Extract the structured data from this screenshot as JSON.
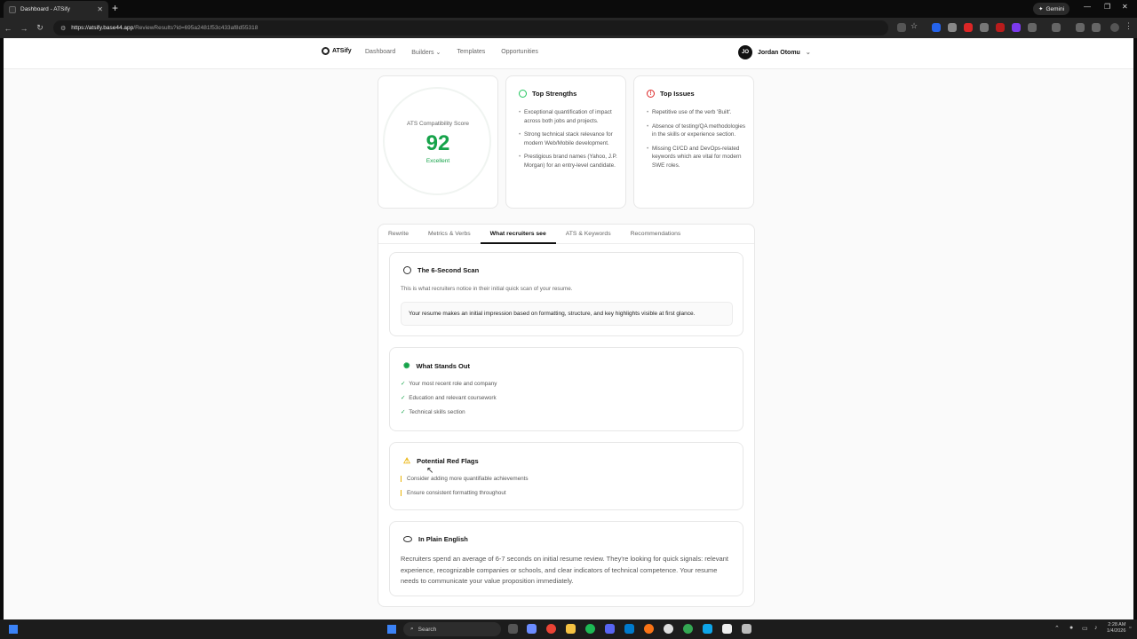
{
  "browser": {
    "tab_title": "Dashboard - ATSify",
    "url_host": "https://atsify.base44.app",
    "url_path": "/ReviewResults?id=695a2481f53c433af8d55318",
    "gemini_label": "Gemini"
  },
  "app": {
    "logo": "ATSify",
    "nav": [
      "Dashboard",
      "Builders",
      "Templates",
      "Opportunities"
    ],
    "user_initials": "JO",
    "user_name": "Jordan Otomu"
  },
  "score": {
    "label": "ATS Compatibility Score",
    "value": "92",
    "rating": "Excellent"
  },
  "strengths": {
    "title": "Top Strengths",
    "items": [
      "Exceptional quantification of impact across both jobs and projects.",
      "Strong technical stack relevance for modern Web/Mobile development.",
      "Prestigious brand names (Yahoo, J.P. Morgan) for an entry-level candidate."
    ]
  },
  "issues": {
    "title": "Top Issues",
    "items": [
      "Repetitive use of the verb 'Built'.",
      "Absence of testing/QA methodologies in the skills or experience section.",
      "Missing CI/CD and DevOps-related keywords which are vital for modern SWE roles."
    ]
  },
  "tabs": [
    "Rewrite",
    "Metrics & Verbs",
    "What recruiters see",
    "ATS & Keywords",
    "Recommendations"
  ],
  "scan": {
    "title": "The 6-Second Scan",
    "desc": "This is what recruiters notice in their initial quick scan of your resume.",
    "quote": "Your resume makes an initial impression based on formatting, structure, and key highlights visible at first glance."
  },
  "standout": {
    "title": "What Stands Out",
    "items": [
      "Your most recent role and company",
      "Education and relevant coursework",
      "Technical skills section"
    ]
  },
  "flags": {
    "title": "Potential Red Flags",
    "items": [
      "Consider adding more quantifiable achievements",
      "Ensure consistent formatting throughout"
    ]
  },
  "plain": {
    "title": "In Plain English",
    "text": "Recruiters spend an average of 6-7 seconds on initial resume review. They're looking for quick signals: relevant experience, recognizable companies or schools, and clear indicators of technical competence. Your resume needs to communicate your value proposition immediately."
  },
  "taskbar": {
    "search": "Search",
    "time": "2:28 AM",
    "date": "1/4/2026"
  },
  "colors": {
    "accent_green": "#16a34a",
    "alert_red": "#dc2626",
    "warn_yellow": "#eab308"
  }
}
